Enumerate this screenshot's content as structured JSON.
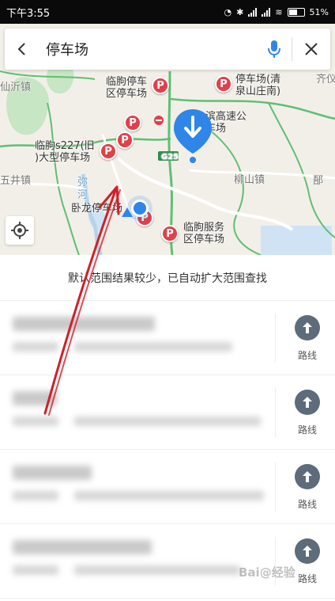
{
  "status_bar": {
    "time": "下午3:55",
    "battery": "51%"
  },
  "search": {
    "query": "停车场"
  },
  "map": {
    "places": {
      "xinyi_town": "仙沂镇",
      "wujing_town": "五井镇",
      "liushan_town": "柳山镇",
      "qiyi_town": "齐仪",
      "yunjiao_town": "郚",
      "mi_river": "弥河",
      "highway": "G25",
      "linqu_lot_1": "临朐停车\n区停车场",
      "qingquan_lot": "停车场(清\n泉山庄南)",
      "expressway_lot": "滨高速公\n车场",
      "s227_lot": "临朐s227(旧\n)大型停车场",
      "wolong_lot": "卧龙停车场",
      "service_lot": "临朐服务\n区停车场"
    },
    "marker_letter": "P"
  },
  "notice": "默认范围结果较少，已自动扩大范围查找",
  "route_label": "路线",
  "results_count": 4,
  "watermark": "Bai@经验",
  "colors": {
    "poi_red": "#e0404a",
    "pin_blue": "#2f86e8",
    "route_icon": "#5d6b7a",
    "annotation": "#d0202a"
  }
}
